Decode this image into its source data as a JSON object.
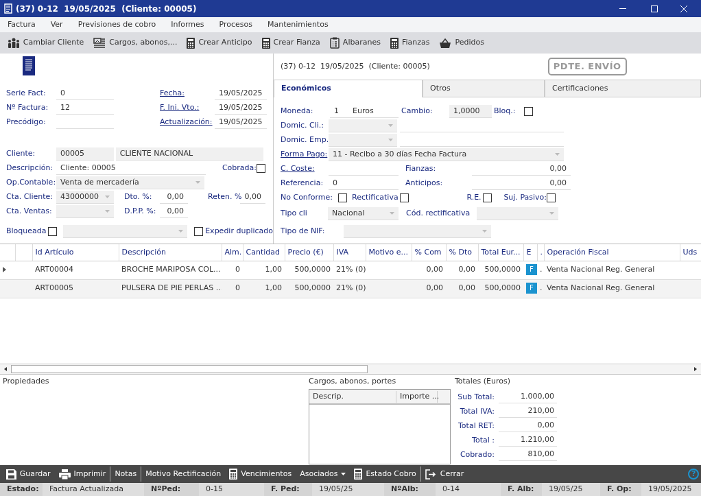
{
  "window": {
    "title": "(37) 0-12  19/05/2025  (Cliente: 00005)"
  },
  "menu": [
    "Factura",
    "Ver",
    "Previsiones de cobro",
    "Informes",
    "Procesos",
    "Mantenimientos"
  ],
  "toolbar": [
    {
      "label": "Cambiar Cliente"
    },
    {
      "label": "Cargos, abonos,..."
    },
    {
      "label": "Crear Anticipo"
    },
    {
      "label": "Crear Fianza"
    },
    {
      "label": "Albaranes"
    },
    {
      "label": "Fianzas"
    },
    {
      "label": "Pedidos"
    }
  ],
  "header": {
    "caption": "(37) 0-12  19/05/2025  (Cliente: 00005)",
    "stamp": "PDTE. ENVÍO"
  },
  "general": {
    "serie_fact": {
      "label": "Serie Fact:",
      "value": "0"
    },
    "n_factura": {
      "label": "Nº Factura:",
      "value": "12"
    },
    "precodigo": {
      "label": "Precódigo:"
    },
    "fecha": {
      "label": "Fecha:",
      "value": "19/05/2025"
    },
    "f_ini_vto": {
      "label": "F. Ini. Vto.:",
      "value": "19/05/2025"
    },
    "actualizacion": {
      "label": "Actualización:",
      "value": "19/05/2025"
    },
    "cliente": {
      "label": "Cliente:",
      "code": "00005",
      "name": "CLIENTE NACIONAL"
    },
    "descripcion": {
      "label": "Descripción:",
      "value": "Cliente: 00005"
    },
    "cobrada": {
      "label": "Cobrada:",
      "checked": false
    },
    "op_contable": {
      "label": "Op.Contable:",
      "value": "Venta de mercadería"
    },
    "cta_cliente": {
      "label": "Cta. Cliente:",
      "value": "43000000"
    },
    "dto": {
      "label": "Dto. %:",
      "value": "0,00"
    },
    "reten": {
      "label": "Reten. %",
      "value": "0,00"
    },
    "cta_ventas": {
      "label": "Cta. Ventas:"
    },
    "dpp": {
      "label": "D.P.P. %:",
      "value": "0,00"
    },
    "bloqueada": {
      "label": "Bloqueada",
      "checked": false
    },
    "expedir_duplicado": {
      "label": "Expedir duplicado",
      "checked": false
    }
  },
  "tabs": [
    {
      "label": "Económicos",
      "selected": true
    },
    {
      "label": "Otros",
      "selected": false
    },
    {
      "label": "Certificaciones",
      "selected": false
    }
  ],
  "economicos": {
    "moneda": {
      "label": "Moneda:",
      "code": "1",
      "name": "Euros"
    },
    "cambio": {
      "label": "Cambio:",
      "value": "1,0000"
    },
    "bloq": {
      "label": "Bloq.:",
      "checked": false
    },
    "domic_cli": {
      "label": "Domic. Cli.:"
    },
    "domic_emp": {
      "label": "Domic. Emp."
    },
    "forma_pago": {
      "label": "Forma Pago:",
      "value": "11 - Recibo a 30 días Fecha Factura"
    },
    "c_coste": {
      "label": "C. Coste:"
    },
    "fianzas": {
      "label": "Fianzas:",
      "value": "0,00"
    },
    "referencia": {
      "label": "Referencia:",
      "value": "0"
    },
    "anticipos": {
      "label": "Anticipos:",
      "value": "0,00"
    },
    "no_conforme": {
      "label": "No Conforme:",
      "checked": false
    },
    "rectificativa": {
      "label": "Rectificativa",
      "checked": false
    },
    "re": {
      "label": "R.E.",
      "checked": false
    },
    "suj_pasivo": {
      "label": "Suj. Pasivo:",
      "checked": false
    },
    "tipo_cli": {
      "label": "Tipo cli",
      "value": "Nacional"
    },
    "cod_rectificativa": {
      "label": "Cód. rectificativa"
    },
    "tipo_nif": {
      "label": "Tipo de NIF:"
    }
  },
  "lines": {
    "columns": [
      "Id Artículo",
      "Descripción",
      "Alm.",
      "Cantidad",
      "Precio (€)",
      "IVA",
      "Motivo e...",
      "% Com",
      "% Dto",
      "Total Eur...",
      "E",
      ".",
      "Operación Fiscal",
      "Uds"
    ],
    "rows": [
      {
        "selected": true,
        "id": "ART00004",
        "descripcion": "BROCHE MARIPOSA COL...",
        "alm": "0",
        "cantidad": "1,00",
        "precio": "500,0000",
        "iva": "21% (0)",
        "com": "0,00",
        "dto": "0,00",
        "total": "500,0000",
        "e": "F",
        "dot": ".",
        "operacion": "Venta Nacional Reg. General"
      },
      {
        "selected": false,
        "id": "ART00005",
        "descripcion": "PULSERA DE PIE PERLAS ...",
        "alm": "0",
        "cantidad": "1,00",
        "precio": "500,0000",
        "iva": "21% (0)",
        "com": "0,00",
        "dto": "0,00",
        "total": "500,0000",
        "e": "F",
        "dot": ".",
        "operacion": "Venta Nacional Reg. General"
      }
    ]
  },
  "propiedades": {
    "title": "Propiedades"
  },
  "cargos": {
    "title": "Cargos, abonos, portes",
    "columns": [
      "Descrip.",
      "Importe ..."
    ]
  },
  "totales": {
    "title": "Totales (Euros)",
    "rows": [
      {
        "label": "Sub Total:",
        "value": "1.000,00"
      },
      {
        "label": "Total IVA:",
        "value": "210,00"
      },
      {
        "label": "Total RET:",
        "value": "0,00"
      },
      {
        "label": "Total :",
        "value": "1.210,00"
      },
      {
        "label": "Cobrado:",
        "value": "810,00"
      }
    ]
  },
  "actions": [
    [
      {
        "label": "Guardar"
      },
      {
        "label": "Imprimir"
      }
    ],
    [
      {
        "label": "Notas"
      }
    ],
    [
      {
        "label": "Motivo Rectificación"
      },
      {
        "label": "Vencimientos"
      },
      {
        "label": "Asociados"
      },
      {
        "label": "Estado Cobro"
      }
    ],
    [
      {
        "label": "Cerrar"
      }
    ]
  ],
  "help": "?",
  "status": [
    {
      "label": "Estado:",
      "value": "Factura Actualizada"
    },
    {
      "label": "NºPed:",
      "value": "0-15"
    },
    {
      "label": "F. Ped:",
      "value": "19/05/25"
    },
    {
      "label": "NºAlb:",
      "value": "0-14"
    },
    {
      "label": "F. Alb:",
      "value": "19/05/25"
    },
    {
      "label": "F. Op:",
      "value": "19/05/2025"
    }
  ]
}
